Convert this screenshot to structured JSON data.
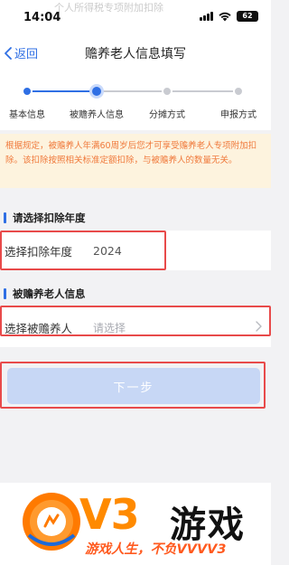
{
  "status_bar": {
    "time": "14:04",
    "battery": "62",
    "overlay_text": "个人所得税专项附加扣除"
  },
  "nav": {
    "back_label": "返回",
    "title": "赡养老人信息填写"
  },
  "stepper": {
    "steps": [
      {
        "label": "基本信息",
        "state": "done"
      },
      {
        "label": "被赡养人信息",
        "state": "current"
      },
      {
        "label": "分摊方式",
        "state": "pending"
      },
      {
        "label": "申报方式",
        "state": "pending"
      }
    ]
  },
  "notice": {
    "text": "根据规定，被赡养人年满60周岁后您才可享受赡养老人专项附加扣除。该扣除按照相关标准定额扣除，与被赡养人的数量无关。"
  },
  "year_section": {
    "title": "请选择扣除年度",
    "field_label": "选择扣除年度",
    "field_value": "2024"
  },
  "elderly_section": {
    "title": "被赡养老人信息",
    "field_label": "选择被赡养人",
    "field_placeholder": "请选择"
  },
  "next_button": {
    "label": "下一步"
  },
  "watermark": {
    "v3": "V3",
    "brand": "游戏",
    "slogan": "游戏人生，不负VVVV3"
  },
  "colors": {
    "accent": "#2f6fe4",
    "notice_text": "#f07a3c",
    "notice_bg": "#fdf3de",
    "highlight": "#e84a4a",
    "button_disabled": "#c7d7f5"
  }
}
